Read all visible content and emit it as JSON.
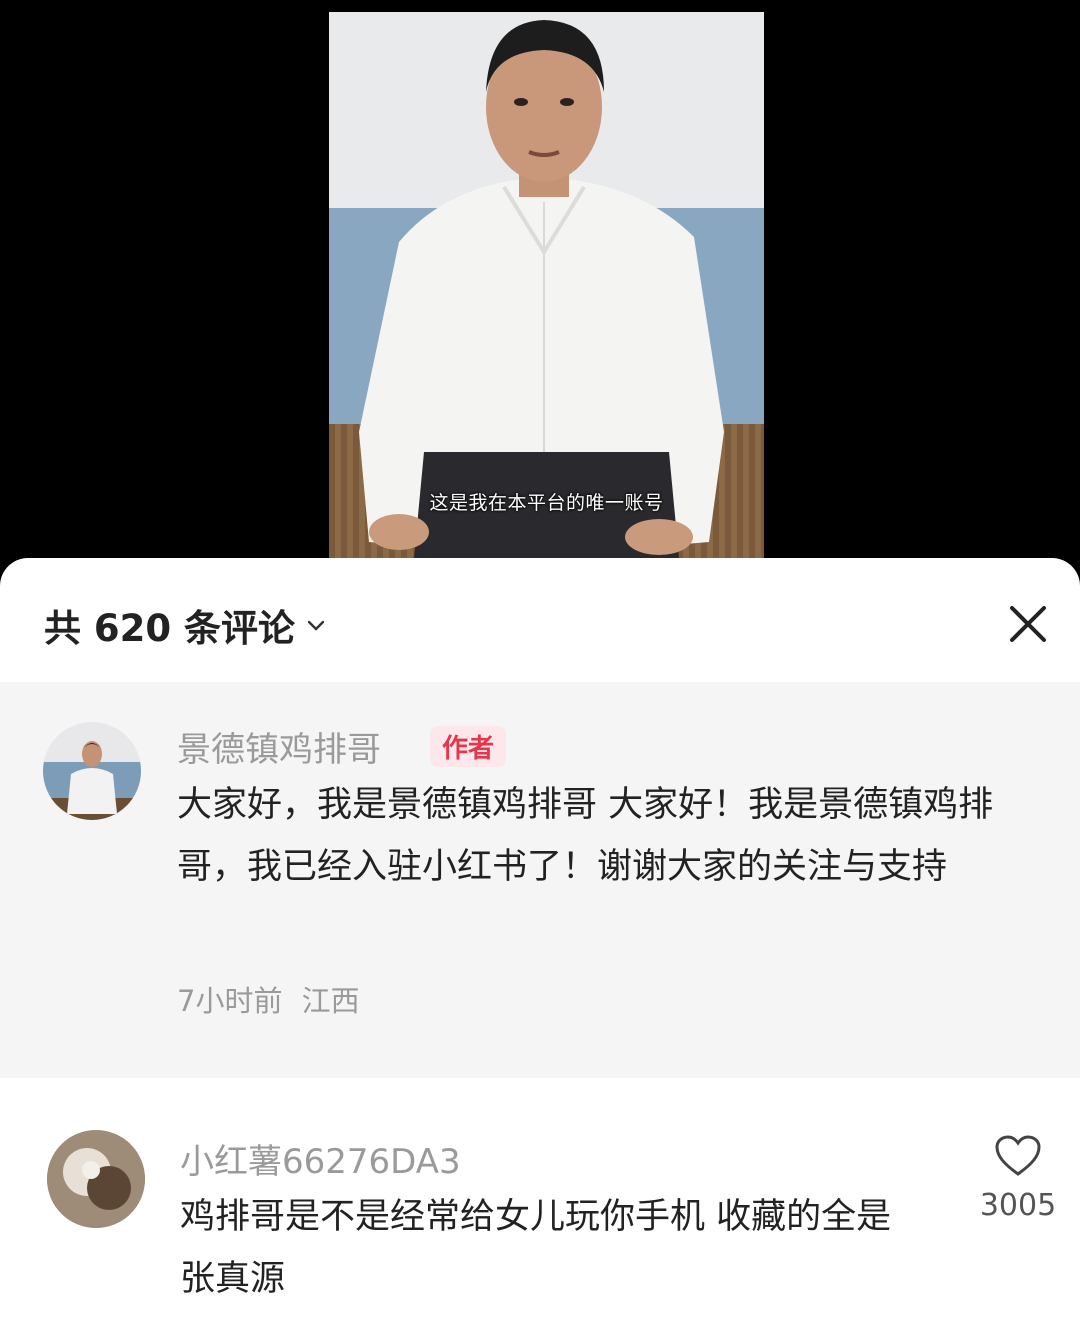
{
  "video": {
    "subtitle": "这是我在本平台的唯一账号"
  },
  "comments_panel": {
    "title": "共 620 条评论",
    "icons": {
      "expand": "chevron-down-icon",
      "close": "close-icon"
    }
  },
  "comments": [
    {
      "username": "景德镇鸡排哥",
      "badge": "作者",
      "text": "大家好，我是景德镇鸡排哥 大家好！我是景德镇鸡排哥，我已经入驻小红书了！谢谢大家的关注与支持",
      "time": "7小时前",
      "location": "江西"
    },
    {
      "username": "小红薯66276DA3",
      "text": "鸡排哥是不是经常给女儿玩你手机 收藏的全是张真源",
      "likes": "3005",
      "like_icon": "heart-icon"
    }
  ],
  "colors": {
    "badge_text": "#e5374c",
    "badge_bg": "#fde7ea",
    "pinned_bg": "#f5f5f5"
  }
}
